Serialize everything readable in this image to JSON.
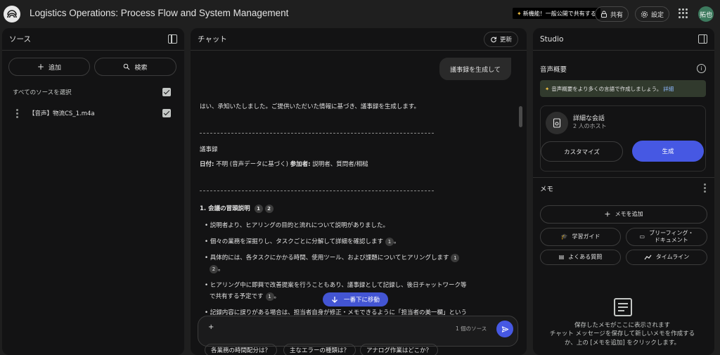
{
  "header": {
    "title": "Logistics Operations: Process Flow and System Management",
    "new_feature_badge": "新機能！一般公開で共有する",
    "share_label": "共有",
    "settings_label": "設定",
    "avatar_text": "拓也"
  },
  "sources": {
    "title": "ソース",
    "add_label": "追加",
    "search_label": "検索",
    "select_all_label": "すべてのソースを選択",
    "items": [
      {
        "name": "【音声】物流CS_1.m4a",
        "checked": true
      }
    ]
  },
  "chat": {
    "title": "チャット",
    "refresh_label": "更新",
    "user_message": "議事録を生成して",
    "intro": "はい、承知いたしました。ご提供いただいた情報に基づき、議事録を生成します。",
    "doc_title": "議事録",
    "meta_date_label": "日付:",
    "meta_date_value": " 不明 (音声データに基づく) ",
    "meta_participants_label": "参加者:",
    "meta_participants_value": " 説明者、質問者/相槌",
    "section1_title": "1. 会議の冒頭説明",
    "section1_cites": [
      "1",
      "2"
    ],
    "bullets": [
      {
        "text": "説明者より、ヒアリングの目的と流れについて説明がありました。",
        "cites": []
      },
      {
        "text": "個々の業務を深掘りし、タスクごとに分解して詳細を確認します",
        "cites": [
          "1"
        ]
      },
      {
        "text": "具体的には、各タスクにかかる時間、使用ツール、および課題についてヒアリングします",
        "cites": [
          "1"
        ],
        "cont_cites": [
          "2"
        ]
      },
      {
        "text": "ヒアリング中に即興で改善提案を行うこともあり、議事録として記録し、後日チャットワーク等",
        "cont_text": "で共有する予定です",
        "cont_cites": [
          "1"
        ]
      },
      {
        "text": "記録内容に誤りがある場合は、担当者自身が修正・メモできるように「担当者の美一欄」という",
        "cites": []
      }
    ],
    "jump_label": "一番下に移動",
    "input_value": "+",
    "source_count": "1 個のソース",
    "suggestions": [
      "各業務の時間配分は？",
      "主なエラーの種類は？",
      "アナログ作業はどこか？"
    ]
  },
  "studio": {
    "title": "Studio",
    "audio_overview_title": "音声概要",
    "banner_text": "音声概要をより多くの言語で作成しましょう。",
    "banner_link": "詳細",
    "card_title": "詳細な会話",
    "card_subtitle": "2 人のホスト",
    "customize_label": "カスタマイズ",
    "generate_label": "生成",
    "memo_title": "メモ",
    "add_memo_label": "メモを追加",
    "study_guide_label": "学習ガイド",
    "briefing_label_1": "ブリーフィング・",
    "briefing_label_2": "ドキュメント",
    "faq_label": "よくある質問",
    "timeline_label": "タイムライン",
    "empty_line1": "保存したメモがここに表示されます",
    "empty_line2": "チャット メッセージを保存して新しいメモを作成する",
    "empty_line3": "か、上の [メモを追加] をクリックします。"
  },
  "colors": {
    "background": "#1f1f1f",
    "panel": "#131314",
    "accent": "#4658e3",
    "link": "#8ab4f8"
  }
}
